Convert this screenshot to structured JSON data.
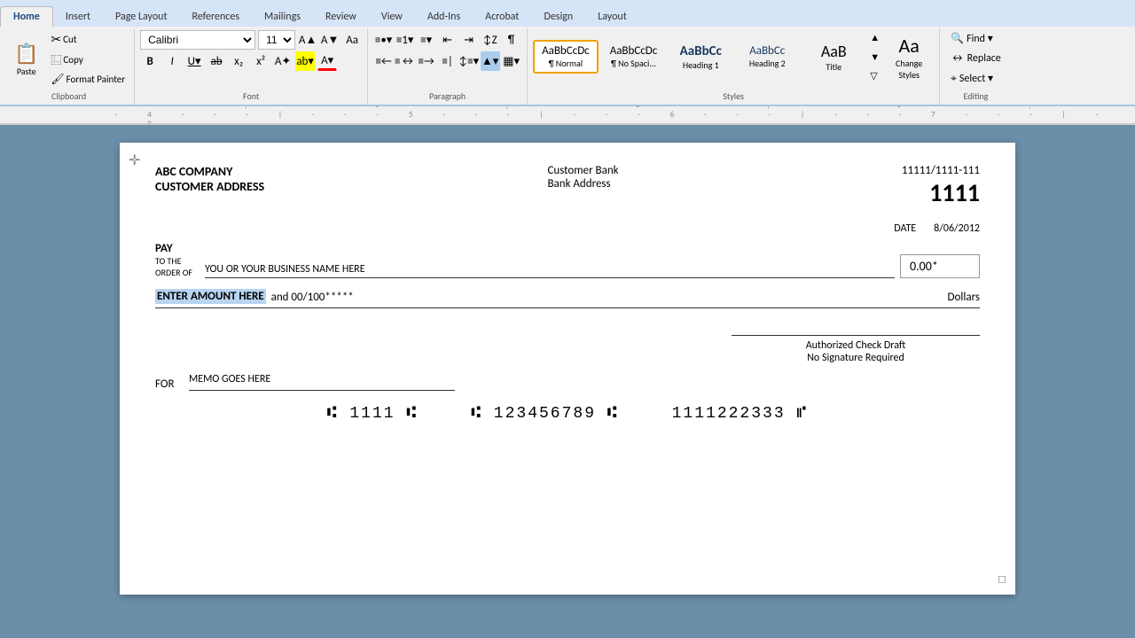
{
  "tabs": [
    {
      "label": "Home",
      "active": true
    },
    {
      "label": "Insert",
      "active": false
    },
    {
      "label": "Page Layout",
      "active": false
    },
    {
      "label": "References",
      "active": false
    },
    {
      "label": "Mailings",
      "active": false
    },
    {
      "label": "Review",
      "active": false
    },
    {
      "label": "View",
      "active": false
    },
    {
      "label": "Add-Ins",
      "active": false
    },
    {
      "label": "Acrobat",
      "active": false
    },
    {
      "label": "Design",
      "active": false
    },
    {
      "label": "Layout",
      "active": false
    }
  ],
  "ribbon": {
    "font": {
      "family": "Calibri",
      "size": "11",
      "group_label": "Font"
    },
    "paragraph": {
      "group_label": "Paragraph"
    },
    "styles": {
      "group_label": "Styles",
      "items": [
        {
          "label": "AaBbCcDc",
          "sublabel": "¶ Normal",
          "type": "normal",
          "active": true
        },
        {
          "label": "AaBbCcDc",
          "sublabel": "¶ No Spaci...",
          "type": "nospace",
          "active": false
        },
        {
          "label": "AaBbCc",
          "sublabel": "Heading 1",
          "type": "h1",
          "active": false
        },
        {
          "label": "AaBbCc",
          "sublabel": "Heading 2",
          "type": "h2",
          "active": false
        },
        {
          "label": "AaB",
          "sublabel": "Title",
          "type": "title",
          "active": false
        }
      ],
      "change_styles_label": "Change\nStyles"
    },
    "editing": {
      "group_label": "Editing",
      "find_label": "Find ▾",
      "replace_label": "Replace",
      "select_label": "Select ▾"
    },
    "clipboard_label": "Clipboard",
    "font_label": "Font",
    "paragraph_label": "Paragraph"
  },
  "check": {
    "company_name": "ABC COMPANY",
    "company_address": "CUSTOMER ADDRESS",
    "bank_name": "Customer Bank",
    "bank_address": "Bank Address",
    "routing_number": "11111/1111-111",
    "check_number": "1111",
    "date_label": "DATE",
    "date_value": "8/06/2012",
    "pay_label_main": "PAY",
    "pay_label_sub1": "TO THE",
    "pay_label_sub2": "ORDER OF",
    "payee_placeholder": "YOU OR YOUR BUSINESS NAME HERE",
    "amount_display": "0.00*",
    "amount_words_highlighted": "ENTER AMOUNT HERE",
    "amount_words_rest": " and 00/100*****",
    "dollars_label": "Dollars",
    "authorized_line1": "Authorized Check Draft",
    "authorized_line2": "No Signature Required",
    "for_label": "FOR",
    "memo_placeholder": "MEMO GOES HERE",
    "micr_check": "⑆ 1111 ⑆",
    "micr_routing": "⑆ 123456789 ⑆",
    "micr_account": "1111222333 ⑈"
  }
}
